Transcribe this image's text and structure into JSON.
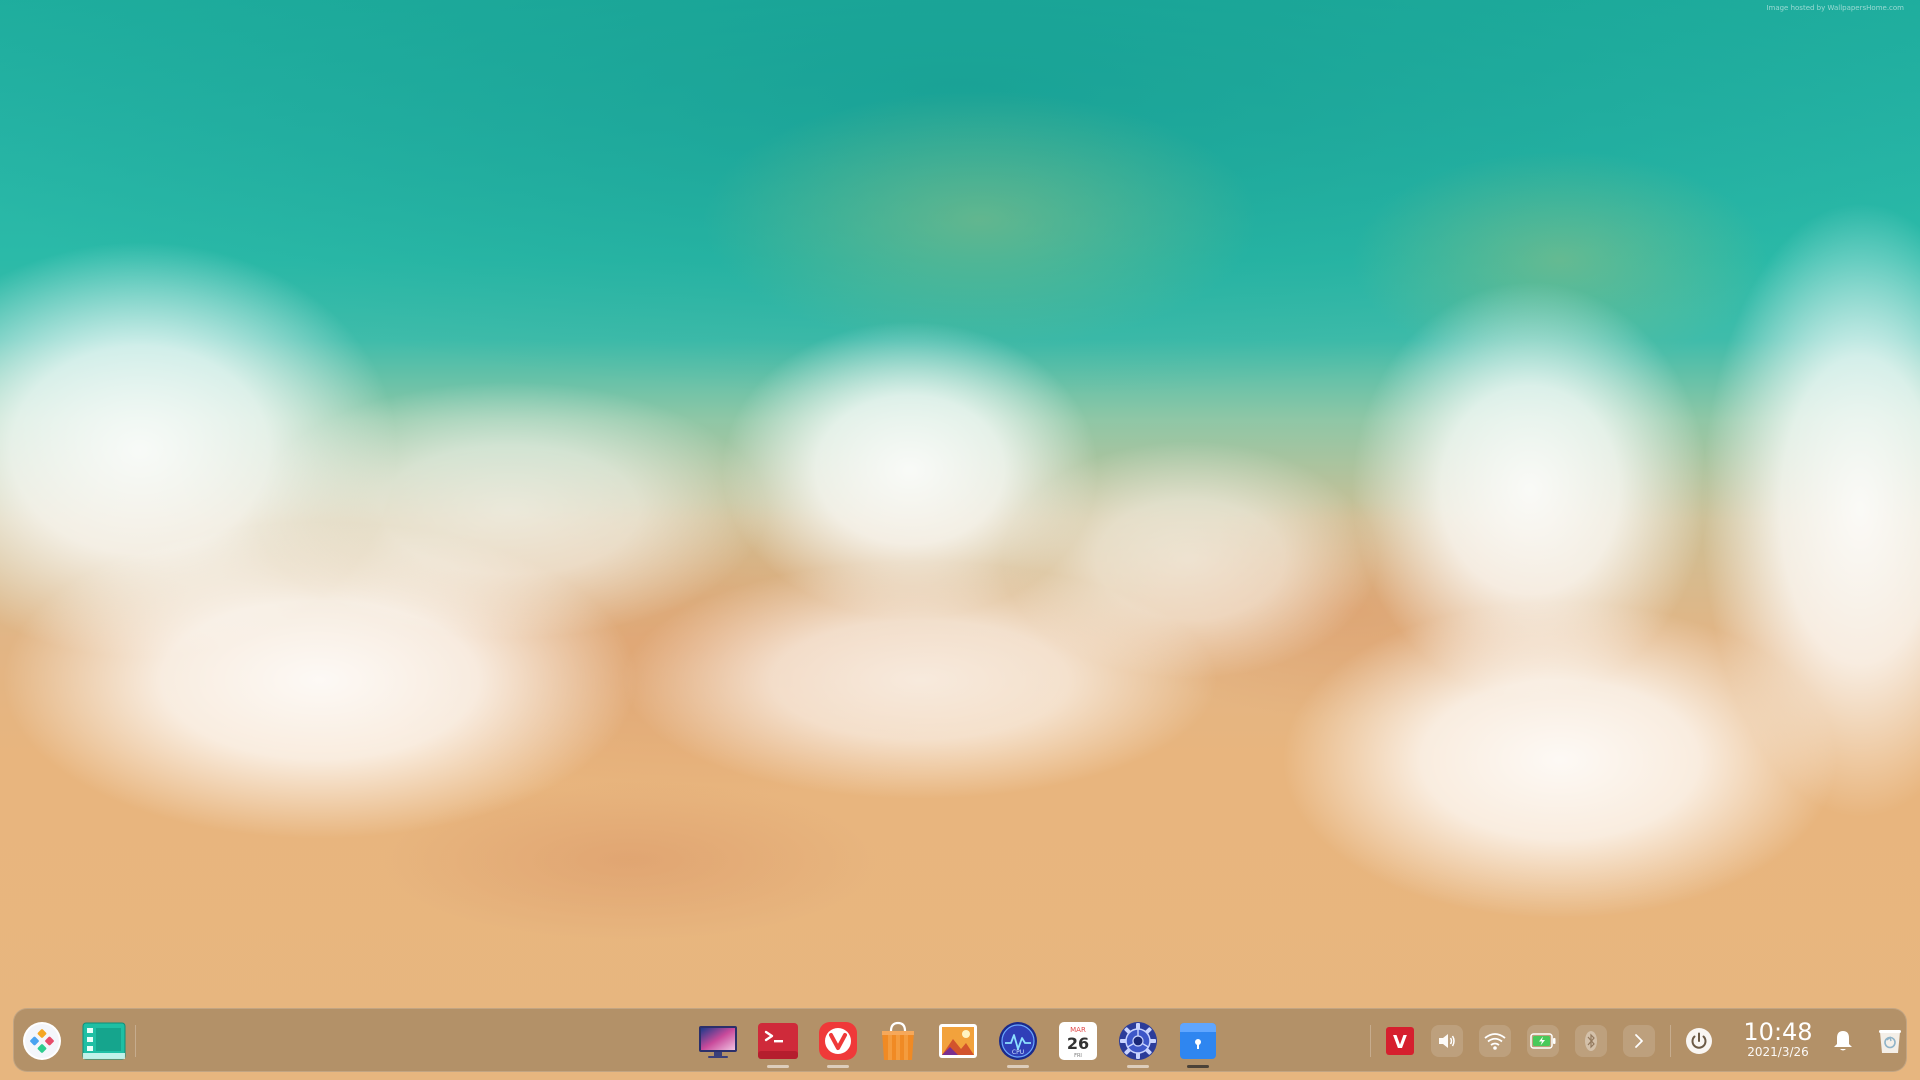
{
  "desktop": {
    "wallpaper_credit": "Image hosted by WallpapersHome.com"
  },
  "dock": {
    "launcher": {
      "icon": "launcher-icon"
    },
    "multitask": {
      "icon": "multitask-view-icon"
    },
    "apps": [
      {
        "name": "Deepin Movie",
        "icon": "monitor-icon",
        "running": false
      },
      {
        "name": "Terminal",
        "icon": "terminal-icon",
        "running": true
      },
      {
        "name": "Vivaldi",
        "icon": "vivaldi-icon",
        "running": true
      },
      {
        "name": "App Store",
        "icon": "store-bag-icon",
        "running": false
      },
      {
        "name": "Image Viewer",
        "icon": "photo-icon",
        "running": false
      },
      {
        "name": "System Monitor",
        "icon": "cpu-monitor-icon",
        "running": true
      },
      {
        "name": "Calendar",
        "icon": "calendar-icon",
        "running": false,
        "month": "MAR",
        "day": "26",
        "weekday": "FRI"
      },
      {
        "name": "Control Center",
        "icon": "settings-gear-icon",
        "running": true
      },
      {
        "name": "Files",
        "icon": "file-manager-icon",
        "running": true,
        "active": true
      }
    ],
    "tray": [
      {
        "name": "vivaldi-tray",
        "icon": "vivaldi-tray-icon",
        "label": "V"
      },
      {
        "name": "volume",
        "icon": "volume-icon"
      },
      {
        "name": "wifi",
        "icon": "wifi-icon"
      },
      {
        "name": "battery",
        "icon": "battery-charging-icon"
      },
      {
        "name": "bluetooth",
        "icon": "bluetooth-icon"
      },
      {
        "name": "expand",
        "icon": "chevron-right-icon"
      }
    ],
    "power": {
      "icon": "power-icon"
    },
    "clock": {
      "time": "10:48",
      "date": "2021/3/26"
    },
    "notifications": {
      "icon": "bell-icon"
    },
    "trash": {
      "icon": "trash-icon"
    }
  }
}
